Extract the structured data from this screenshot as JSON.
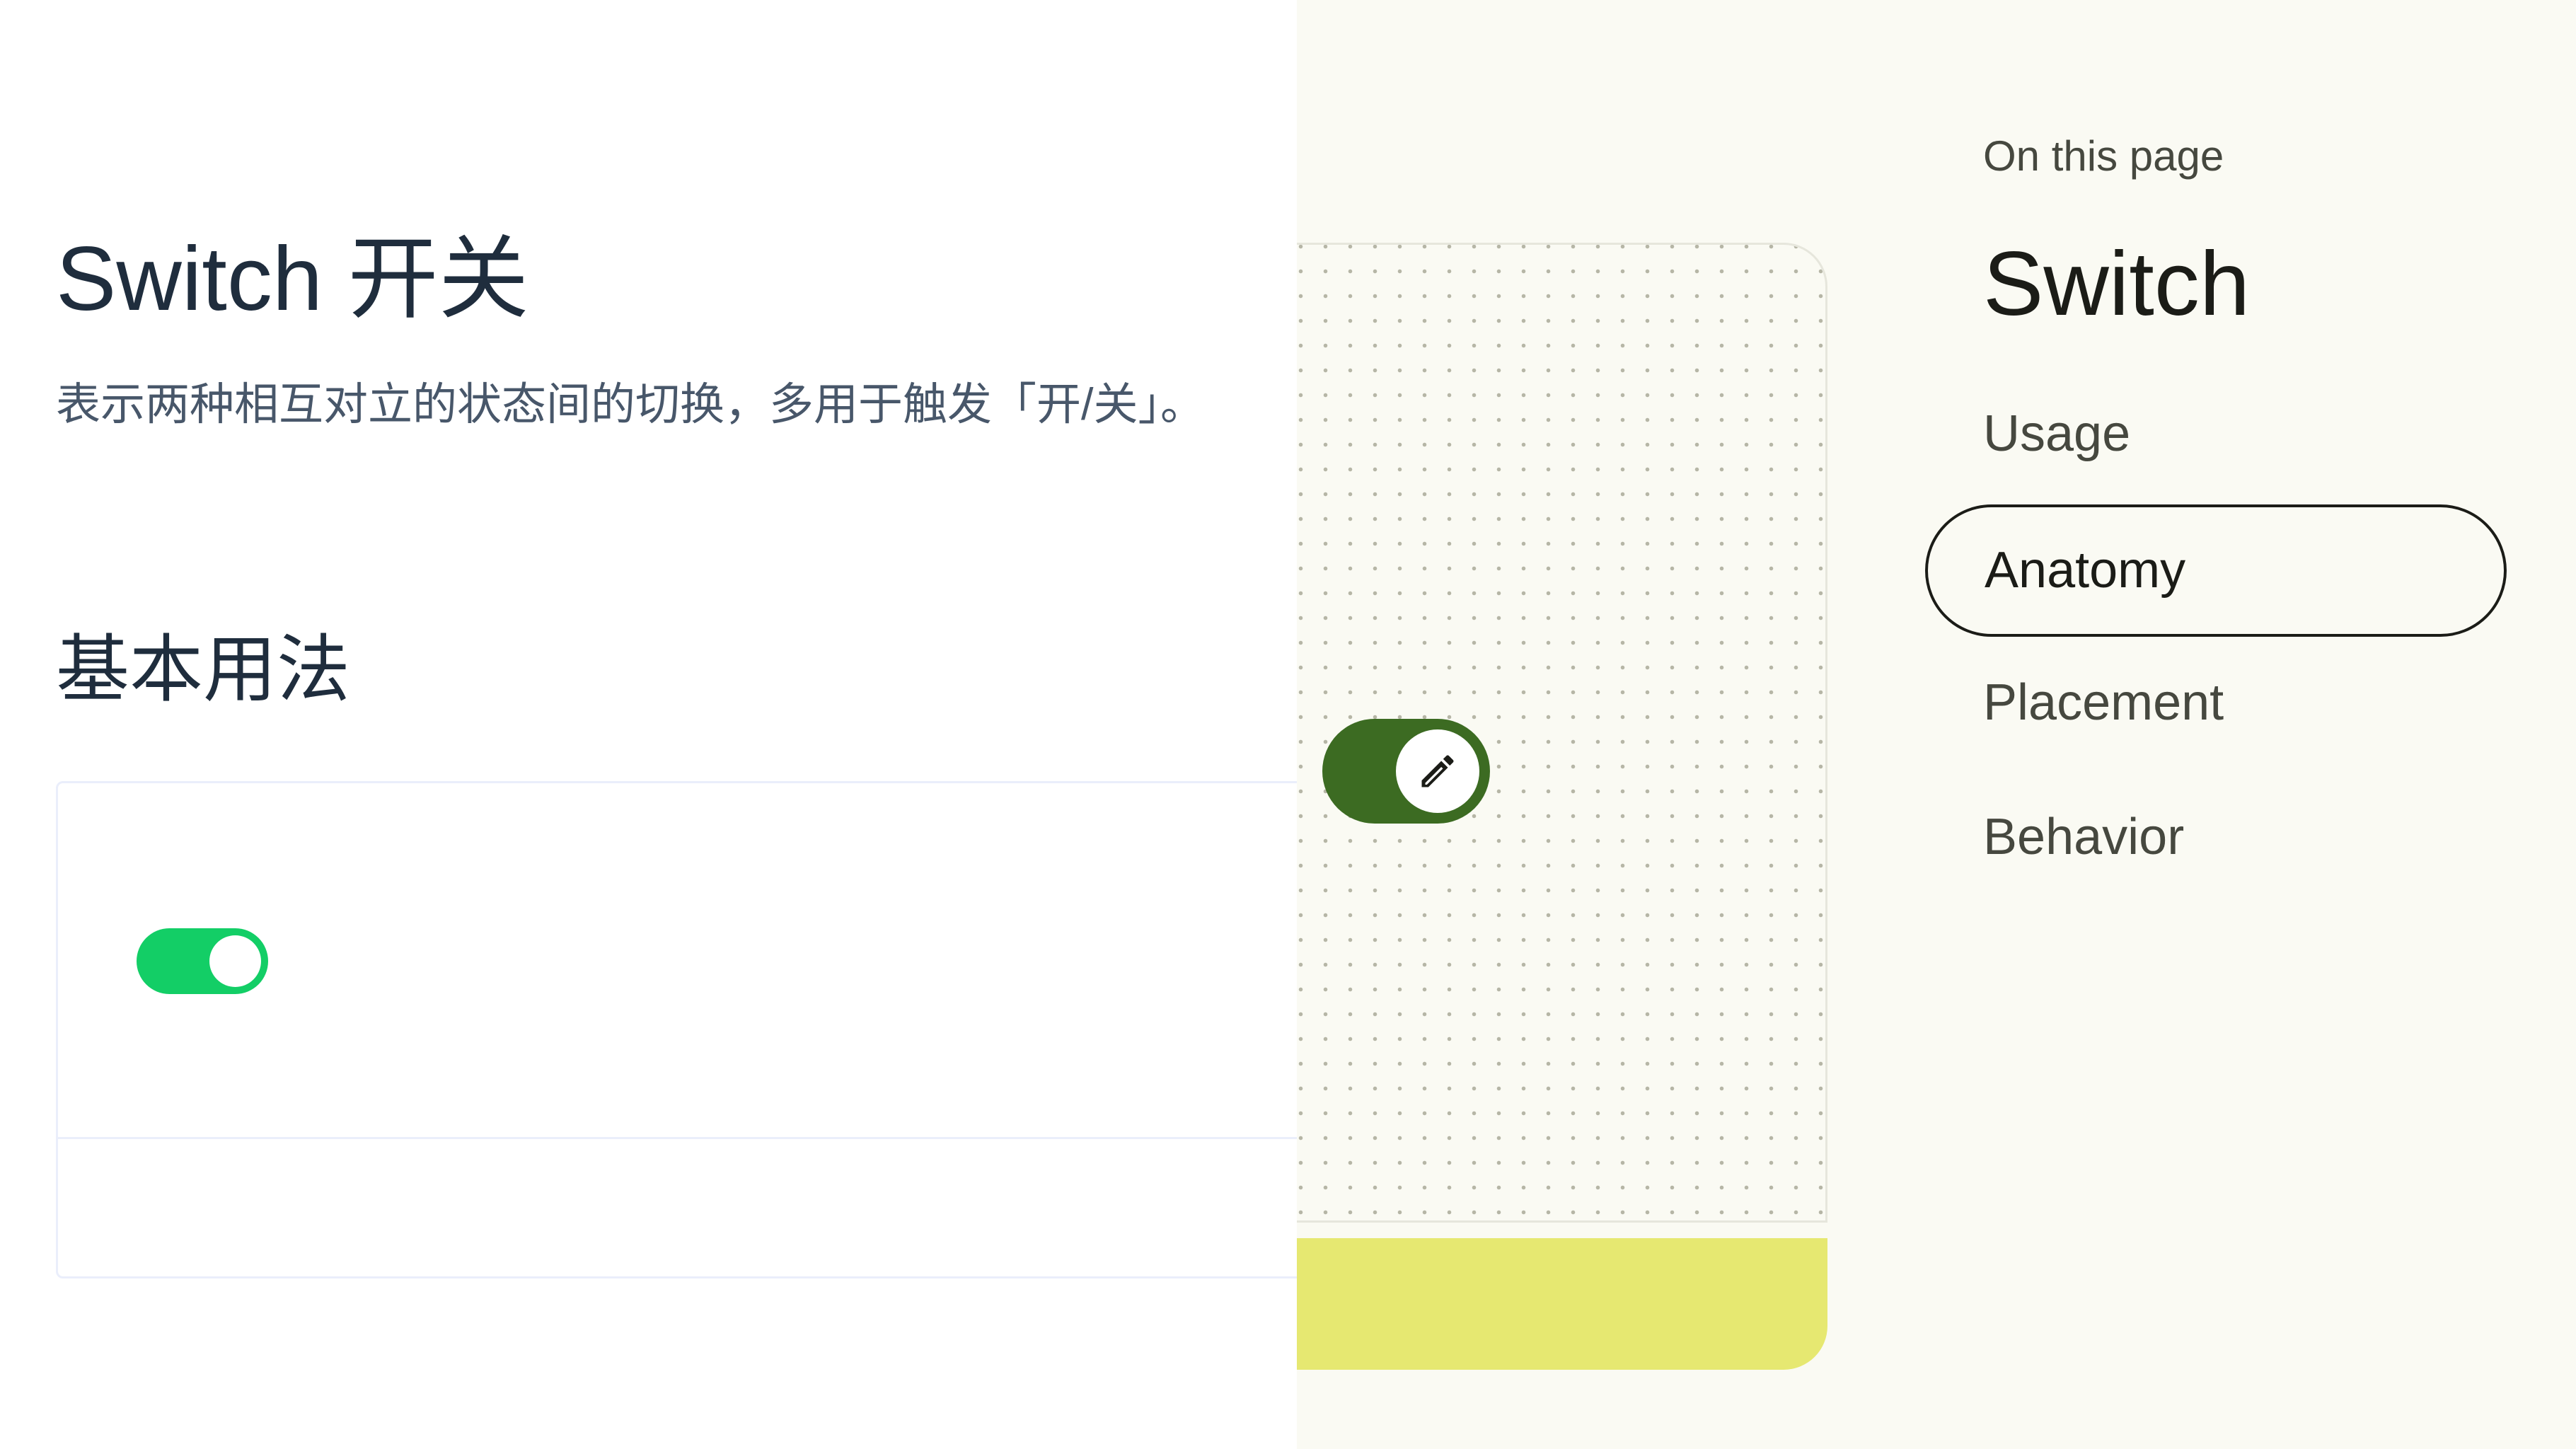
{
  "left": {
    "title": "Switch 开关",
    "description": "表示两种相互对立的状态间的切换，多用于触发「开/关」。",
    "section_title": "基本用法",
    "switch": {
      "state": "on",
      "active_color": "#13ce66"
    }
  },
  "right": {
    "demo_switch": {
      "state": "on",
      "track_color": "#3c6b22",
      "handle_icon": "pencil-icon"
    },
    "banner_color": "#e6e871",
    "toc": {
      "heading": "On this page",
      "title": "Switch",
      "items": [
        {
          "label": "Usage",
          "active": false
        },
        {
          "label": "Anatomy",
          "active": true
        },
        {
          "label": "Placement",
          "active": false
        },
        {
          "label": "Behavior",
          "active": false
        }
      ]
    }
  }
}
